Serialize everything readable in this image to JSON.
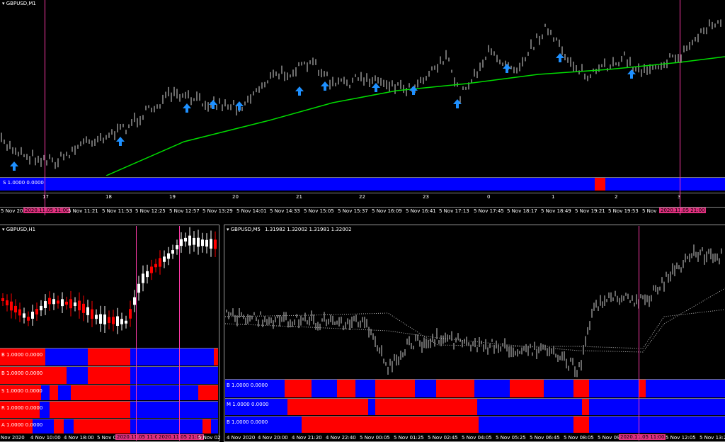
{
  "colors": {
    "background": "#000000",
    "bull": "#ff0000",
    "bear": "#0000ff",
    "ma": "#00dd00",
    "arrow": "#1e90ff",
    "marker": "#ff3aa8"
  },
  "top": {
    "title": "GBPUSD,M1",
    "strip_label": "S 1.0000 0.0000",
    "subaxis": [
      "17",
      "18",
      "19",
      "20",
      "21",
      "22",
      "23",
      "0",
      "1",
      "2",
      "3"
    ],
    "time_axis": [
      "5 Nov 2020",
      "5 Nov 11:21",
      "5 Nov 11:53",
      "5 Nov 12:25",
      "5 Nov 12:57",
      "5 Nov 13:29",
      "5 Nov 14:01",
      "5 Nov 14:33",
      "5 Nov 15:05",
      "5 Nov 15:37",
      "5 Nov 16:09",
      "5 Nov 16:41",
      "5 Nov 17:13",
      "5 Nov 17:45",
      "5 Nov 18:17",
      "5 Nov 18:49",
      "5 Nov 19:21",
      "5 Nov 19:53",
      "5 Nov"
    ],
    "tags": [
      "2020.11.05 11:00",
      "2020.11.05 21:00"
    ]
  },
  "h1": {
    "title": "GBPUSD,H1",
    "strips": [
      "B 1.0000 0.0000",
      "B 1.0000 0.0000",
      "S 1.0000 0.0000",
      "R 1.0000 0.0000",
      "A 1.0000 0.0000"
    ],
    "time_axis": [
      "Nov 2020",
      "4 Nov 10:00",
      "4 Nov 18:00",
      "5 Nov 02:00",
      "5 Nov 02"
    ],
    "tags": [
      "2020.11.05 11:00",
      "2020.11.05 21:00"
    ]
  },
  "m5": {
    "title": "GBPUSD,M5",
    "ohlc": "1.31982 1.32002 1.31981 1.32002",
    "strips": [
      "B 1.0000 0.0000",
      "M 1.0000 0.0000",
      "B 1.0000 0.0000"
    ],
    "time_axis": [
      "4 Nov 2020",
      "4 Nov 20:00",
      "4 Nov 21:20",
      "4 Nov 22:40",
      "5 Nov 00:05",
      "5 Nov 01:25",
      "5 Nov 02:45",
      "5 Nov 04:05",
      "5 Nov 05:25",
      "5 Nov 06:45",
      "5 Nov 08:05",
      "5 Nov 09",
      "5 Nov 12:05",
      "5 Nov 13:2"
    ],
    "tags": [
      "2020.11.05 11:00"
    ]
  }
}
